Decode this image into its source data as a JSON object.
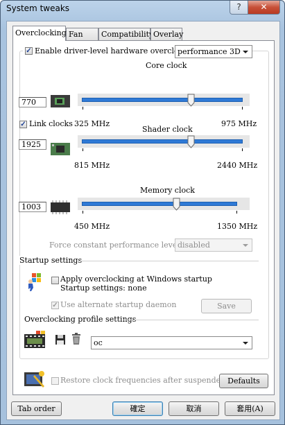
{
  "window": {
    "title": "System tweaks",
    "help_glyph": "?",
    "close_glyph": "✕"
  },
  "tabs": [
    {
      "label": "Overclocking",
      "active": true
    },
    {
      "label": "Fan"
    },
    {
      "label": "Compatibility"
    },
    {
      "label": "Overlay"
    }
  ],
  "overclocking": {
    "enable_label": "Enable driver-level hardware overclocking",
    "enable_checked": true,
    "profile_mode": "performance 3D",
    "core": {
      "title": "Core clock",
      "value": "770",
      "min": "325 MHz",
      "max": "975 MHz",
      "level": 0.68
    },
    "link_clocks_label": "Link clocks",
    "link_clocks_checked": true,
    "shader": {
      "title": "Shader clock",
      "value": "1925",
      "min": "815 MHz",
      "max": "2440 MHz",
      "level": 0.68
    },
    "memory": {
      "title": "Memory clock",
      "value": "1003",
      "min": "450 MHz",
      "max": "1350 MHz",
      "level": 0.61
    },
    "force_label": "Force constant performance level",
    "force_value": "disabled"
  },
  "startup": {
    "section_title": "Startup settings",
    "apply_label": "Apply overclocking at Windows startup",
    "settings_text": "Startup settings: none",
    "alternate_label": "Use alternate startup daemon",
    "save_label": "Save"
  },
  "profile": {
    "section_title": "Overclocking profile settings",
    "selected": "oc"
  },
  "restore_label": "Restore clock frequencies after suspended mode",
  "defaults_label": "Defaults",
  "footer": {
    "tab_order": "Tab order",
    "ok": "確定",
    "cancel": "取消",
    "apply": "套用(A)"
  },
  "colors": {
    "track": "#2f7ad6",
    "title_bar": "#a9c4df",
    "close_button": "#c75038"
  }
}
